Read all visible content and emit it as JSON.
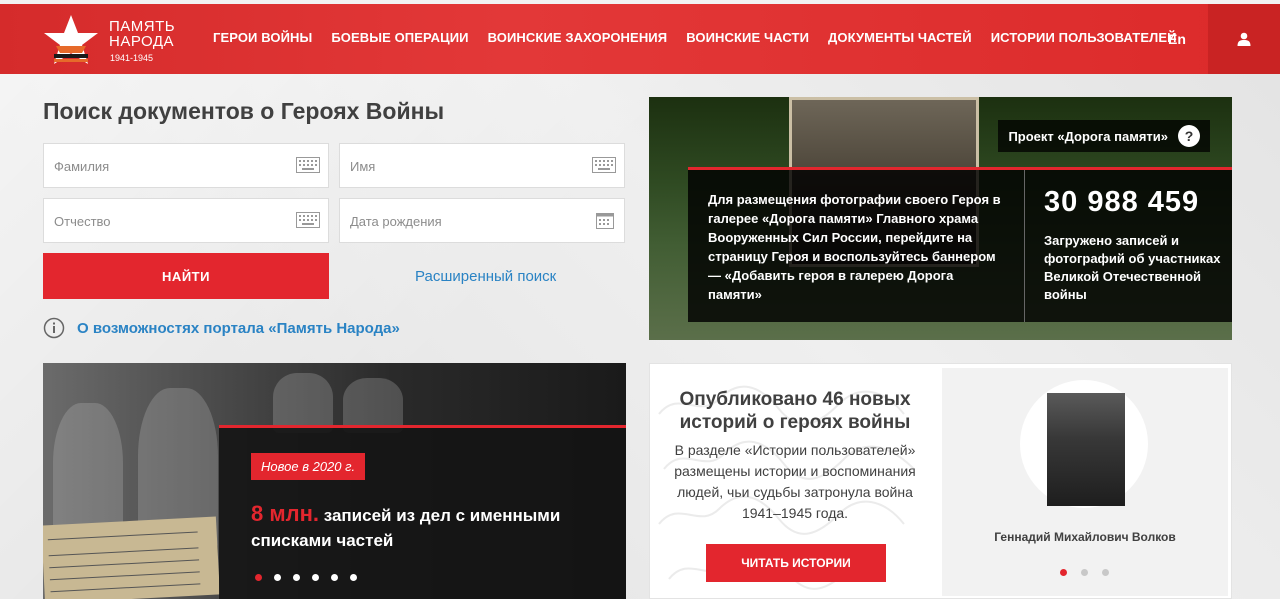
{
  "header": {
    "logo": {
      "line1": "ПАМЯТЬ",
      "line2": "НАРОДА",
      "years": "1941-1945"
    },
    "nav": [
      {
        "label": "ГЕРОИ ВОЙНЫ"
      },
      {
        "label": "БОЕВЫЕ ОПЕРАЦИИ"
      },
      {
        "label": "ВОИНСКИЕ ЗАХОРОНЕНИЯ"
      },
      {
        "label": "ВОИНСКИЕ ЧАСТИ"
      },
      {
        "label": "ДОКУМЕНТЫ ЧАСТЕЙ"
      },
      {
        "label": "ИСТОРИИ ПОЛЬЗОВАТЕЛЕЙ"
      }
    ],
    "lang": "En",
    "user_icon": "user-icon"
  },
  "search": {
    "title": "Поиск документов о Героях Войны",
    "fields": {
      "surname": "Фамилия",
      "name": "Имя",
      "patronymic": "Отчество",
      "birthdate": "Дата рождения"
    },
    "find_label": "НАЙТИ",
    "advanced_label": "Расширенный поиск",
    "about_label": "О возможностях портала «Память Народа»"
  },
  "banner": {
    "project_label": "Проект «Дорога памяти»",
    "help_mark": "?",
    "description": "Для размещения фотографии своего Героя в галерее «Дорога памяти» Главного храма Вооруженных Сил России, перейдите на страницу Героя и воспользуйтесь баннером — «Добавить героя в галерею Дорога памяти»",
    "count": "30 988 459",
    "count_description": "Загружено записей и фотографий об участниках Великой Отечественной войны"
  },
  "news": {
    "tag": "Новое в 2020 г.",
    "headline_big": "8 млн.",
    "headline_rest": " записей из дел с именными списками частей",
    "dots": 6,
    "active_dot": 0
  },
  "stories": {
    "title": "Опубликовано 46 новых историй о героях войны",
    "text": "В разделе «Истории пользователей» размещены истории и воспоминания людей, чьи судьбы затронула война 1941–1945 года.",
    "read_label": "ЧИТАТЬ ИСТОРИИ",
    "hero_name": "Геннадий Михайлович Волков",
    "dots": 3,
    "active_dot": 0
  },
  "colors": {
    "accent": "#e3262e",
    "link": "#2a83c4"
  }
}
